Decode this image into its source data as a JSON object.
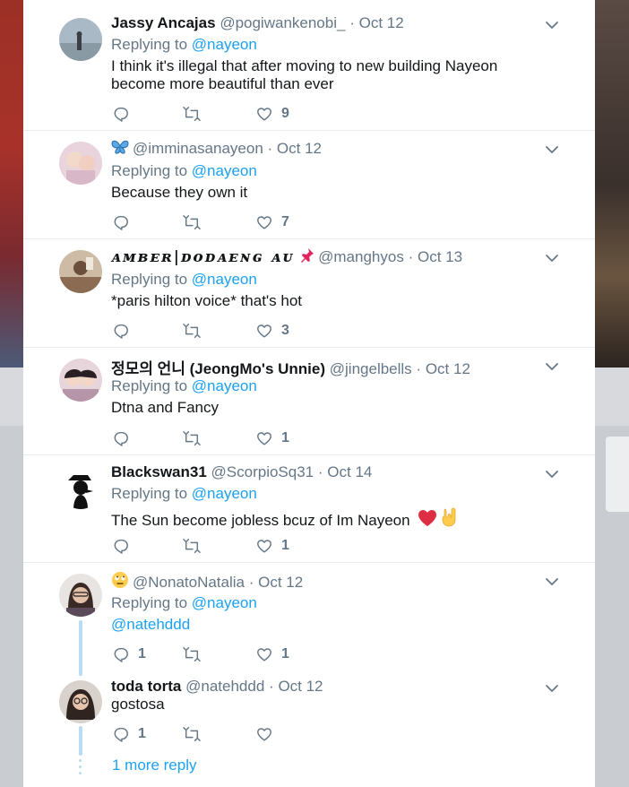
{
  "tweets": [
    {
      "name": "Jassy Ancajas",
      "handle": "@pogiwankenobi_",
      "date": "Oct 12",
      "replying_prefix": "Replying to",
      "replying_to": "@nayeon",
      "text": "I think it's illegal that after moving to new building Nayeon become more beautiful than ever",
      "likes": "9"
    },
    {
      "handle": "@imminasanayeon",
      "date": "Oct 12",
      "replying_prefix": "Replying to",
      "replying_to": "@nayeon",
      "text": "Because they own it",
      "likes": "7"
    },
    {
      "name": "ᴀᴍʙᴇʀ|ᴅᴏᴅᴀᴇɴɢ ᴀᴜ",
      "handle": "@manghyos",
      "date": "Oct 13",
      "replying_prefix": "Replying to",
      "replying_to": "@nayeon",
      "text": "*paris hilton voice* that's hot",
      "likes": "3"
    },
    {
      "name": "정모의 언니 (JeongMo's Unnie)",
      "handle": "@jingelbells",
      "date": "Oct 12",
      "replying_prefix": "Replying to",
      "replying_to": "@nayeon",
      "text": "Dtna and Fancy",
      "likes": "1"
    },
    {
      "name": "Blackswan31",
      "handle": "@ScorpioSq31",
      "date": "Oct 14",
      "replying_prefix": "Replying to",
      "replying_to": "@nayeon",
      "text": "The Sun become jobless bcuz of Im Nayeon",
      "likes": "1"
    },
    {
      "handle": "@NonatoNatalia",
      "date": "Oct 12",
      "replying_prefix": "Replying to",
      "replying_to": "@nayeon",
      "text": "@natehddd",
      "replies": "1",
      "likes": "1"
    },
    {
      "name": "toda torta",
      "handle": "@natehddd",
      "date": "Oct 12",
      "text": "gostosa",
      "replies": "1"
    }
  ],
  "more_reply": "1 more reply",
  "separator": "·",
  "colors": {
    "link": "#1da1f2",
    "muted": "#657786",
    "text": "#14171a",
    "thread": "#b7dcf7"
  }
}
